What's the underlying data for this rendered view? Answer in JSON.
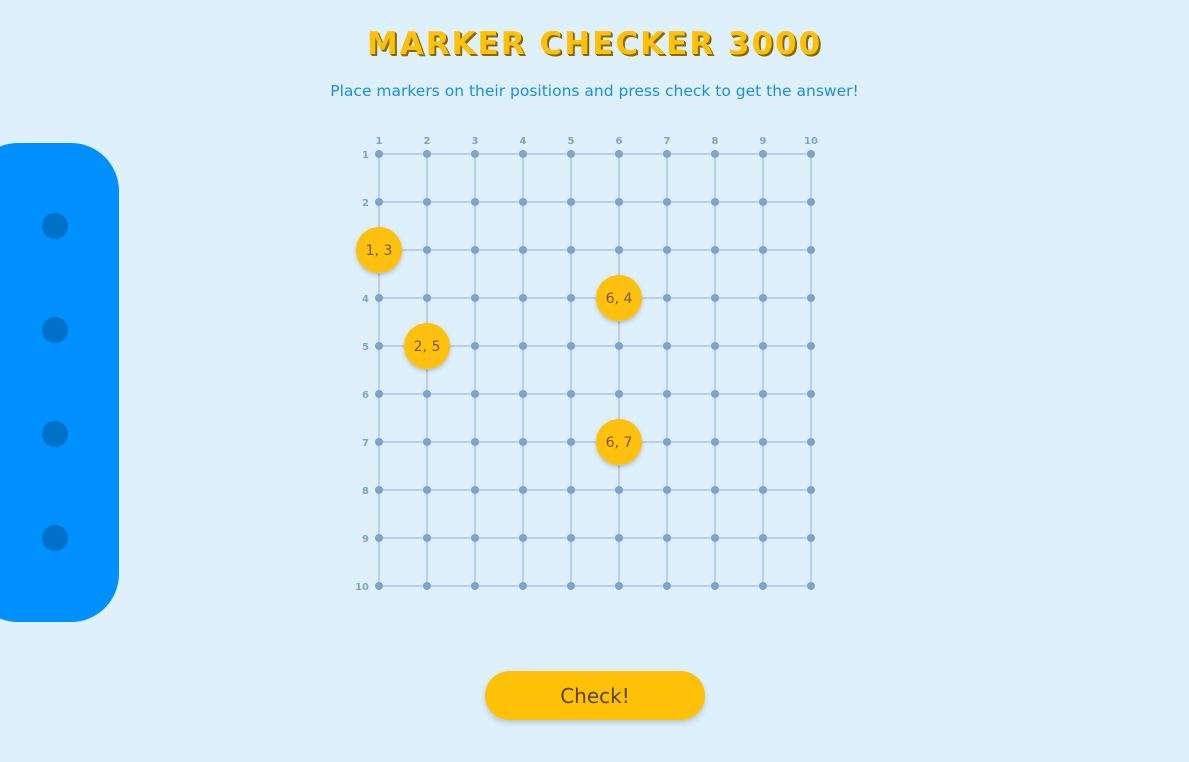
{
  "header": {
    "title": "MARKER CHECKER 3000",
    "subtitle": "Place markers on their positions and press check to get the answer!"
  },
  "tray": {
    "slot_count": 4
  },
  "grid": {
    "columns": [
      "1",
      "2",
      "3",
      "4",
      "5",
      "6",
      "7",
      "8",
      "9",
      "10"
    ],
    "rows": [
      "1",
      "2",
      "3",
      "4",
      "5",
      "6",
      "7",
      "8",
      "9",
      "10"
    ]
  },
  "markers": [
    {
      "label": "1, 3",
      "x": 1,
      "y": 3
    },
    {
      "label": "6, 4",
      "x": 6,
      "y": 4
    },
    {
      "label": "2, 5",
      "x": 2,
      "y": 5
    },
    {
      "label": "6, 7",
      "x": 6,
      "y": 7
    }
  ],
  "actions": {
    "check_label": "Check!"
  },
  "colors": {
    "background": "#dff0fd",
    "title": "#ffc107",
    "subtitle": "#1a8fe8",
    "tray": "#0090ff",
    "tray_slot": "#0170c7",
    "grid_line": "#8fb2d6",
    "grid_dot": "#7da3cf",
    "marker": "#ffc107",
    "marker_text": "#7a5a00",
    "button": "#ffc107"
  }
}
